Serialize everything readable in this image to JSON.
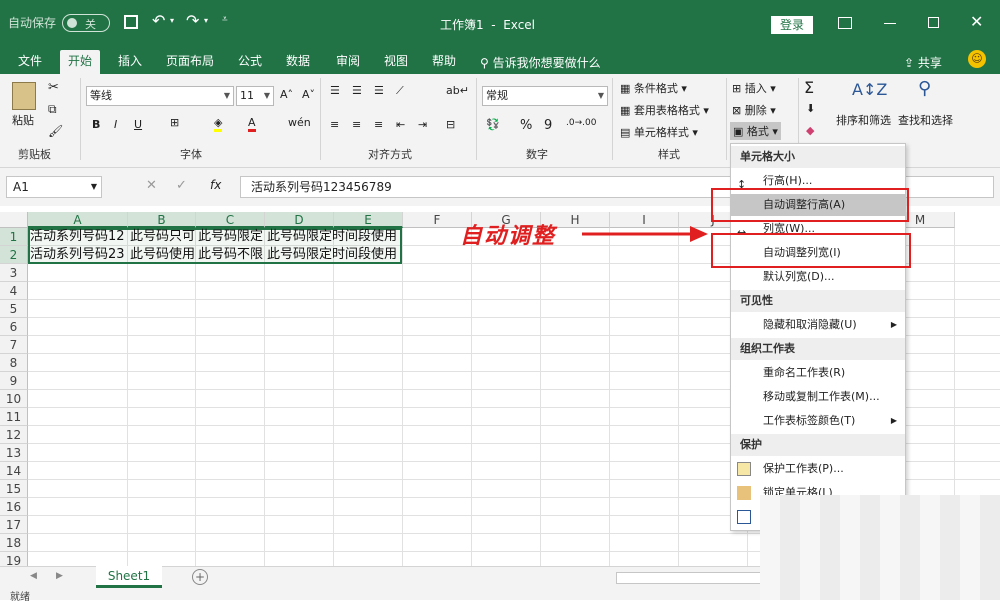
{
  "titlebar": {
    "autosave_label": "自动保存",
    "autosave_state": "关",
    "title": "工作簿1  -  Excel",
    "login_label": "登录"
  },
  "tabs": [
    "文件",
    "开始",
    "插入",
    "页面布局",
    "公式",
    "数据",
    "审阅",
    "视图",
    "帮助"
  ],
  "tell_me": "告诉我你想要做什么",
  "share_label": "共享",
  "ribbon": {
    "clipboard": {
      "paste": "粘贴",
      "group": "剪贴板"
    },
    "font": {
      "name": "等线",
      "size": "11",
      "group": "字体",
      "bold": "B",
      "italic": "I",
      "underline": "U"
    },
    "alignment": {
      "group": "对齐方式"
    },
    "number": {
      "format": "常规",
      "group": "数字",
      "percent": "%",
      "comma": "9"
    },
    "styles": {
      "conditional": "条件格式",
      "table": "套用表格格式",
      "cell": "单元格样式",
      "group": "样式"
    },
    "cells": {
      "insert": "插入",
      "delete": "删除",
      "format": "格式"
    },
    "editing": {
      "sort": "排序和筛选",
      "find": "查找和选择"
    }
  },
  "formula_bar": {
    "name_box": "A1",
    "content": "活动系列号码123456789",
    "fx": "fx"
  },
  "columns": [
    "A",
    "B",
    "C",
    "D",
    "E",
    "F",
    "G",
    "H",
    "I",
    "J",
    "K",
    "L",
    "M"
  ],
  "rows": [
    "1",
    "2",
    "3",
    "4",
    "5",
    "6",
    "7",
    "8",
    "9",
    "10",
    "11",
    "12",
    "13",
    "14",
    "15",
    "16",
    "17",
    "18",
    "19"
  ],
  "cells": {
    "r1": [
      "活动系列号码12",
      "此号码只可",
      "此号码限定",
      "此号码限定时间段使用"
    ],
    "r2": [
      "活动系列号码23",
      "此号码使用",
      "此号码不限",
      "此号码限定时间段使用"
    ]
  },
  "annotation": {
    "text": "自动调整",
    "color": "#e02020"
  },
  "format_menu": {
    "sec_size": "单元格大小",
    "row_height": "行高(H)...",
    "autofit_row": "自动调整行高(A)",
    "col_width": "列宽(W)...",
    "autofit_col": "自动调整列宽(I)",
    "default_width": "默认列宽(D)...",
    "sec_visibility": "可见性",
    "hide_unhide": "隐藏和取消隐藏(U)",
    "sec_organize": "组织工作表",
    "rename": "重命名工作表(R)",
    "move_copy": "移动或复制工作表(M)...",
    "tab_color": "工作表标签颜色(T)",
    "sec_protect": "保护",
    "protect_sheet": "保护工作表(P)...",
    "lock_cell": "锁定单元格(L)"
  },
  "sheet_tab": "Sheet1",
  "status": "就绪",
  "colors": {
    "brand": "#217346",
    "highlight": "#c6c6c6",
    "red": "#e02020"
  }
}
